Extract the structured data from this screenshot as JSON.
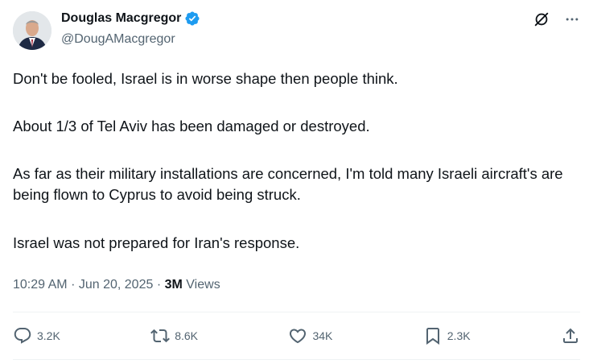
{
  "author": {
    "name": "Douglas Macgregor",
    "handle": "@DougAMacgregor",
    "verified_color": "#1d9bf0"
  },
  "header_icons": [
    "grok-icon",
    "more-icon"
  ],
  "tweet": {
    "paragraphs": [
      "Don't be fooled, Israel is in worse shape then people think.",
      "About 1/3 of Tel Aviv has been damaged or destroyed.",
      "As far as their military installations are concerned, I'm told many Israeli aircraft's are being flown to Cyprus to avoid being struck.",
      "Israel was not prepared for Iran's response."
    ]
  },
  "meta": {
    "time": "10:29 AM",
    "sep1": "·",
    "date": "Jun 20, 2025",
    "sep2": "·",
    "views_count": "3M",
    "views_label": "Views"
  },
  "actions": {
    "reply": "3.2K",
    "repost": "8.6K",
    "like": "34K",
    "bookmark": "2.3K"
  }
}
